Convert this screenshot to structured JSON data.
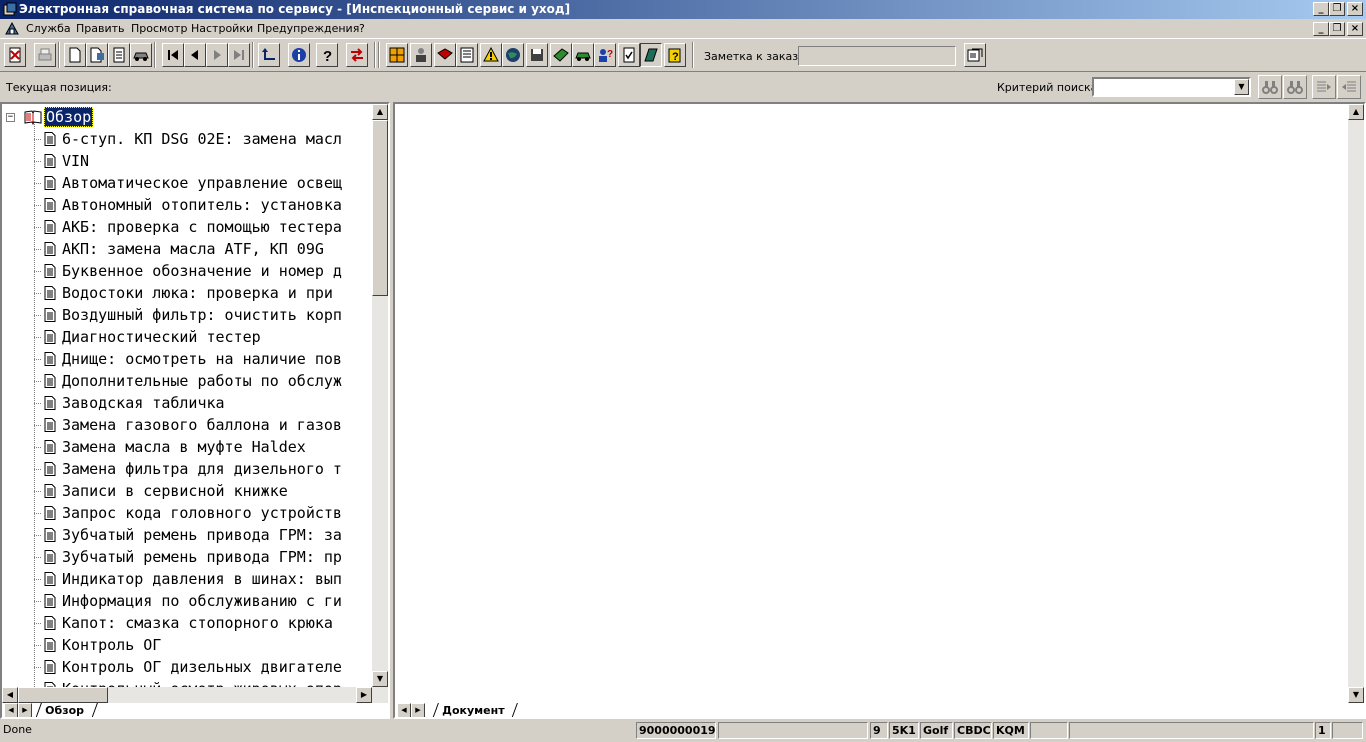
{
  "window": {
    "title": "Электронная справочная система по сервису - [Инспекционный сервис и уход]",
    "min_icon": "minimize-icon",
    "restore_icon": "restore-icon",
    "close_icon": "close-icon"
  },
  "menu": {
    "items": [
      "Служба",
      "Править",
      "Просмотр",
      "Настройки",
      "Предупреждения",
      "?"
    ]
  },
  "toolbar": {
    "note_label": "Заметка к заказу:",
    "note_value": ""
  },
  "position_bar": {
    "current_position_label": "Текущая позиция:",
    "search_criteria_label": "Критерий поиска:",
    "search_criteria_value": ""
  },
  "tree": {
    "root_label": "Обзор",
    "items": [
      "6-ступ. КП DSG 02E: замена масл",
      "VIN",
      "Автоматическое управление освещ",
      "Автономный отопитель: установка",
      "АКБ: проверка с помощью тестера",
      "АКП: замена масла ATF, КП 09G",
      "Буквенное обозначение и номер д",
      "Водостоки люка: проверка и при",
      "Воздушный фильтр: очистить корп",
      "Диагностический тестер",
      "Днище: осмотреть на наличие пов",
      "Дополнительные работы по обслуж",
      "Заводская табличка",
      "Замена газового баллона и газов",
      "Замена масла в муфте Haldex",
      "Замена фильтра для дизельного т",
      "Записи в сервисной книжке",
      "Запрос кода головного устройств",
      "Зубчатый ремень привода ГРМ: за",
      "Зубчатый ремень привода ГРМ: пр",
      "Индикатор давления в шинах: вып",
      "Информация по обслуживанию с ги",
      "Капот: смазка стопорного крюка",
      "Контроль ОГ",
      "Контроль ОГ дизельных двигателе",
      "Контрольный осмотр жировых опор"
    ],
    "tab_label": "Обзор"
  },
  "document": {
    "tab_label": "Документ"
  },
  "status": {
    "text": "Done",
    "panels": [
      "9000000019",
      "",
      "9",
      "5K1",
      "Golf",
      "CBDC",
      "KQM",
      "",
      "",
      "1",
      ""
    ]
  },
  "colors": {
    "face": "#d4d0c8",
    "title_start": "#0a246a",
    "title_end": "#a6caf0",
    "selection": "#0a246a"
  }
}
